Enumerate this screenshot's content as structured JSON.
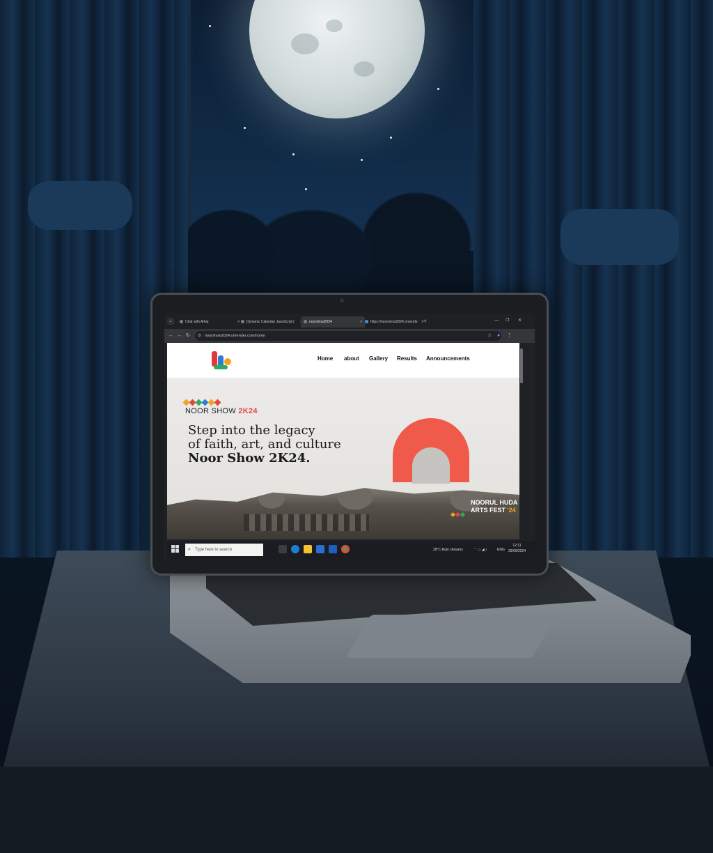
{
  "browser": {
    "tabs": [
      {
        "label": "Chat with Arkiq",
        "active": false
      },
      {
        "label": "Dynamic Calendar JavaScript |",
        "active": false
      },
      {
        "label": "noorshow2024",
        "active": true
      },
      {
        "label": "https://noorshow2024.onrende",
        "active": false
      }
    ],
    "address": "noorshow2024.onrender.com/home"
  },
  "site": {
    "nav": {
      "links": [
        "Home",
        "about",
        "Gallery",
        "Results",
        "Announcements"
      ]
    },
    "hero": {
      "brand_prefix": "NOOR SHOW ",
      "brand_accent": "2K24",
      "headline_line1": "Step into the legacy",
      "headline_line2": "of faith, art, and culture",
      "headline_line3": "Noor Show 2K24.",
      "fest_line1": "NOORUL HUDA",
      "fest_line2_prefix": "ARTS FEST ",
      "fest_line2_accent": "'24"
    },
    "colors": {
      "accent_red": "#f05a4b",
      "diamonds": [
        "#f4a21c",
        "#e5473e",
        "#2eac5d",
        "#2f7bd1",
        "#f4a21c",
        "#e5473e"
      ]
    }
  },
  "taskbar": {
    "search_placeholder": "Type here to search",
    "weather": "28°C  Rain showers",
    "lang": "ENG",
    "time": "12:11",
    "date": "29/09/2024"
  },
  "icons": [
    "search-icon",
    "windows-start-icon",
    "edge-icon",
    "chrome-icon",
    "folder-icon"
  ]
}
